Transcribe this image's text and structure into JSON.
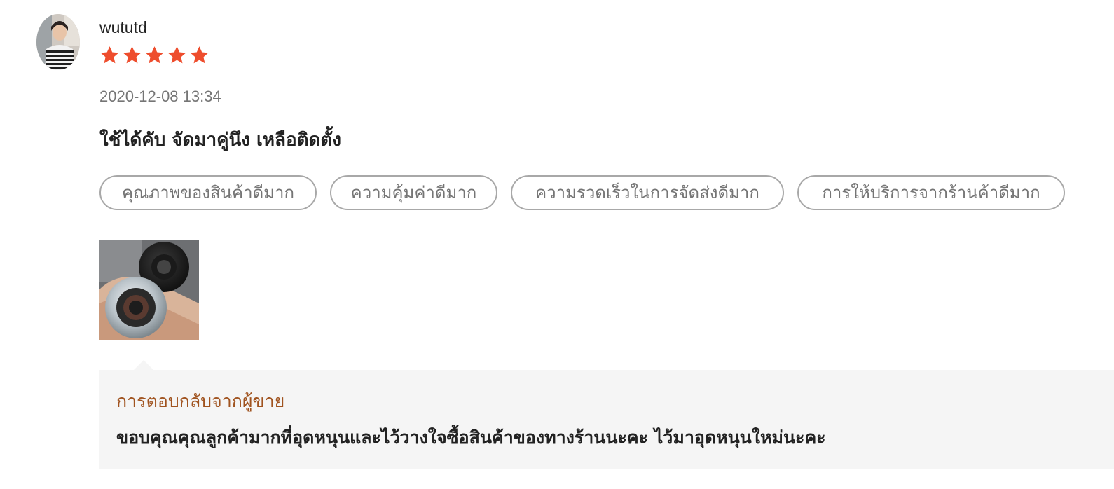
{
  "review": {
    "username": "wututd",
    "rating": 5,
    "star_color": "#ee4d2d",
    "timestamp": "2020-12-08 13:34",
    "comment": "ใช้ได้คับ จัดมาคู่นึง เหลือติดตั้ง",
    "tags": [
      "คุณภาพของสินค้าดีมาก",
      "ความคุ้มค่าดีมาก",
      "ความรวดเร็วในการจัดส่งดีมาก",
      "การให้บริการจากร้านค้าดีมาก"
    ],
    "avatar_icon": "user-avatar-photo",
    "media_icon": "product-photo-thumbnail"
  },
  "seller_reply": {
    "heading": "การตอบกลับจากผู้ขาย",
    "text": "ขอบคุณคุณลูกค้ามากที่อุดหนุนและไว้วางใจซื้อสินค้าของทางร้านนะคะ ไว้มาอุดหนุนใหม่นะคะ",
    "heading_color": "#a0531f",
    "background_color": "#f5f5f5"
  }
}
